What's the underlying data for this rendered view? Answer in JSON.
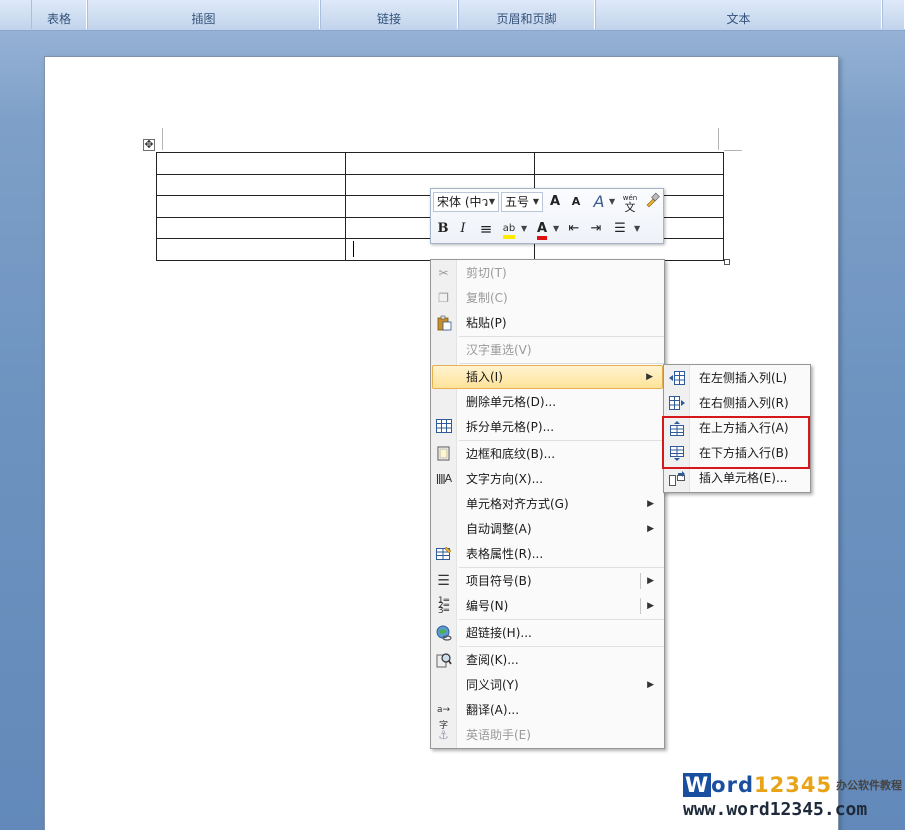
{
  "ribbon": {
    "groups": [
      "表格",
      "插图",
      "链接",
      "页眉和页脚",
      "文本"
    ]
  },
  "document": {
    "table": {
      "rows": 5,
      "cols": 3
    },
    "move_handle_glyph": "✥"
  },
  "mini_toolbar": {
    "font_name": "宋体 (中ว",
    "font_size": "五号",
    "grow_font": "A",
    "shrink_font": "A",
    "styles": "A",
    "phonetic": "wén\n文",
    "format_painter": "brush-icon",
    "bold": "B",
    "italic": "I",
    "center": "≡",
    "highlight": "ab",
    "font_color": "A",
    "decrease_indent": "⇤",
    "increase_indent": "⇥",
    "bullets": "☰"
  },
  "context_menu": {
    "items": [
      {
        "label": "剪切(T)",
        "icon": "scissors-icon",
        "enabled": false
      },
      {
        "label": "复制(C)",
        "icon": "copy-icon",
        "enabled": false
      },
      {
        "label": "粘贴(P)",
        "icon": "paste-icon",
        "enabled": true
      },
      {
        "label": "汉字重选(V)",
        "icon": "",
        "enabled": false
      },
      {
        "label": "插入(I)",
        "icon": "",
        "enabled": true,
        "submenu": true,
        "highlighted": true
      },
      {
        "label": "删除单元格(D)...",
        "icon": "",
        "enabled": true
      },
      {
        "label": "拆分单元格(P)...",
        "icon": "split-cells-icon",
        "enabled": true
      },
      {
        "label": "边框和底纹(B)...",
        "icon": "borders-icon",
        "enabled": true
      },
      {
        "label": "文字方向(X)...",
        "icon": "text-direction-icon",
        "enabled": true
      },
      {
        "label": "单元格对齐方式(G)",
        "icon": "",
        "enabled": true,
        "submenu": true
      },
      {
        "label": "自动调整(A)",
        "icon": "",
        "enabled": true,
        "submenu": true
      },
      {
        "label": "表格属性(R)...",
        "icon": "table-properties-icon",
        "enabled": true
      },
      {
        "label": "项目符号(B)",
        "icon": "bullets-icon",
        "enabled": true,
        "submenu": true
      },
      {
        "label": "编号(N)",
        "icon": "numbering-icon",
        "enabled": true,
        "submenu": true
      },
      {
        "label": "超链接(H)...",
        "icon": "hyperlink-icon",
        "enabled": true
      },
      {
        "label": "查阅(K)...",
        "icon": "research-icon",
        "enabled": true
      },
      {
        "label": "同义词(Y)",
        "icon": "",
        "enabled": true,
        "submenu": true
      },
      {
        "label": "翻译(A)...",
        "icon": "translate-icon",
        "enabled": true
      },
      {
        "label": "英语助手(E)",
        "icon": "english-assistant-icon",
        "enabled": false
      }
    ]
  },
  "insert_submenu": {
    "items": [
      {
        "label": "在左侧插入列(L)",
        "icon": "insert-column-left-icon"
      },
      {
        "label": "在右侧插入列(R)",
        "icon": "insert-column-right-icon"
      },
      {
        "label": "在上方插入行(A)",
        "icon": "insert-row-above-icon",
        "emphasized": true
      },
      {
        "label": "在下方插入行(B)",
        "icon": "insert-row-below-icon",
        "emphasized": true
      },
      {
        "label": "插入单元格(E)...",
        "icon": "insert-cells-icon"
      }
    ]
  },
  "watermark": {
    "logo_w": "W",
    "logo_ord": "ord",
    "logo_num": "12345",
    "tagline": "办公软件教程",
    "url": "www.word12345.com"
  },
  "colors": {
    "highlight_box": "#d4181c",
    "menu_highlight": "#ffe39a"
  }
}
